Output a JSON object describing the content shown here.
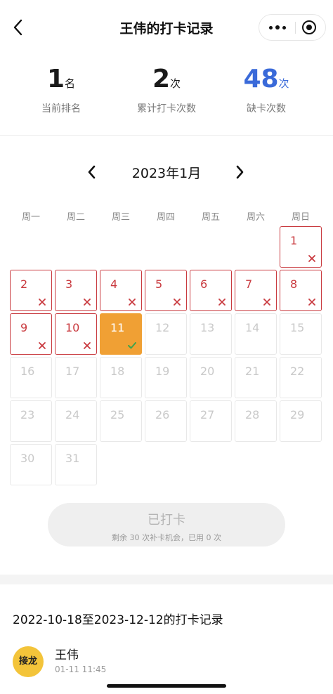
{
  "header": {
    "title": "王伟的打卡记录",
    "back_icon": "chevron-left-icon",
    "more_icon": "more-dots-icon",
    "close_icon": "target-icon"
  },
  "stats": [
    {
      "value": "1",
      "unit": "名",
      "label": "当前排名",
      "color": "#1a1a1a"
    },
    {
      "value": "2",
      "unit": "次",
      "label": "累计打卡次数",
      "color": "#1a1a1a"
    },
    {
      "value": "48",
      "unit": "次",
      "label": "缺卡次数",
      "color": "#3a6ad9"
    }
  ],
  "calendar": {
    "month_label": "2023年1月",
    "weekdays": [
      "周一",
      "周二",
      "周三",
      "周四",
      "周五",
      "周六",
      "周日"
    ],
    "first_weekday_index": 6,
    "days_in_month": 31,
    "missed_days": [
      1,
      2,
      3,
      4,
      5,
      6,
      7,
      8,
      9,
      10
    ],
    "checked_days": [
      11
    ],
    "missed_color": "#c93a3f",
    "checked_color": "#f0a034"
  },
  "checkin": {
    "label": "已打卡",
    "sub": "剩余 30 次补卡机会，已用 0 次"
  },
  "records": {
    "title": "2022-10-18至2023-12-12的打卡记录",
    "items": [
      {
        "avatar_text": "接龙",
        "name": "王伟",
        "time": "01-11 11:45"
      }
    ]
  }
}
